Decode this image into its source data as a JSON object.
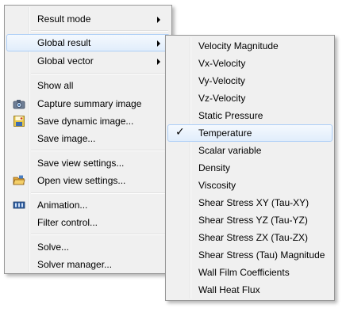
{
  "main_menu": {
    "result_mode": "Result mode",
    "global_result": "Global result",
    "global_vector": "Global vector",
    "show_all": "Show all",
    "capture_summary_image": "Capture summary image",
    "save_dynamic_image": "Save dynamic image...",
    "save_image": "Save image...",
    "save_view_settings": "Save view settings...",
    "open_view_settings": "Open view settings...",
    "animation": "Animation...",
    "filter_control": "Filter control...",
    "solve": "Solve...",
    "solver_manager": "Solver manager..."
  },
  "global_result_submenu": {
    "checked_item": "Temperature",
    "items": [
      "Velocity Magnitude",
      "Vx-Velocity",
      "Vy-Velocity",
      "Vz-Velocity",
      "Static Pressure",
      "Temperature",
      "Scalar variable",
      "Density",
      "Viscosity",
      "Shear Stress XY (Tau-XY)",
      "Shear Stress YZ (Tau-YZ)",
      "Shear Stress ZX (Tau-ZX)",
      "Shear Stress (Tau) Magnitude",
      "Wall Film Coefficients",
      "Wall Heat Flux"
    ]
  },
  "icons": {
    "capture_summary_image": "camera-icon",
    "save_dynamic_image": "save-dynamic-image-icon",
    "open_view_settings": "open-folder-icon",
    "animation": "film-icon"
  },
  "colors": {
    "menu_background": "#f0f0f0",
    "highlight_border": "#aecff7",
    "highlight_fill": "#e1edfb"
  }
}
